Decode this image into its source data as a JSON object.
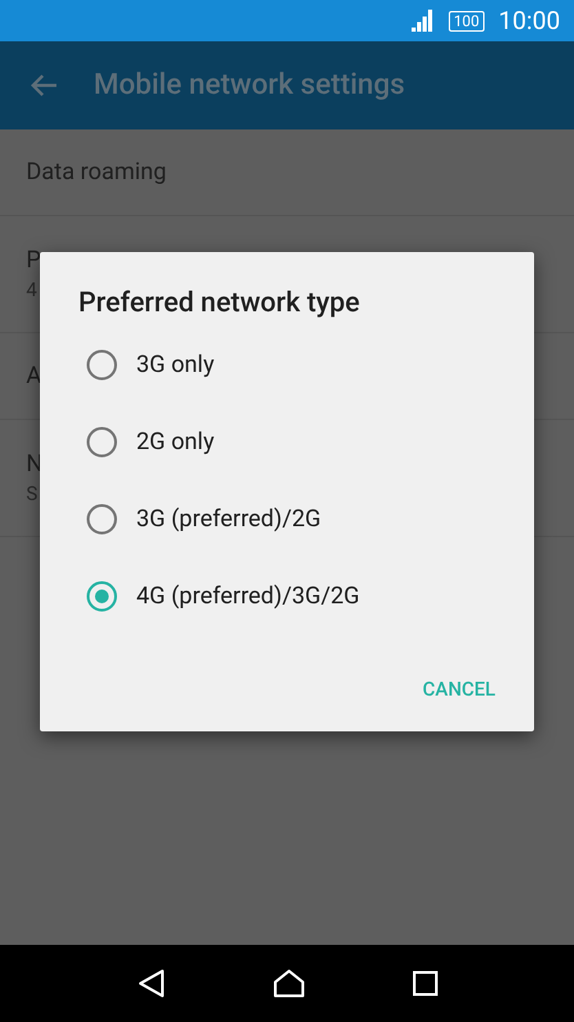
{
  "status_bar": {
    "battery": "100",
    "time": "10:00"
  },
  "app_bar": {
    "title": "Mobile network settings"
  },
  "settings": [
    {
      "title": "Data roaming"
    },
    {
      "title": "P",
      "subtitle": "4"
    },
    {
      "title": "A"
    },
    {
      "title": "N",
      "subtitle": "S"
    }
  ],
  "dialog": {
    "title": "Preferred network type",
    "options": [
      {
        "label": "3G only",
        "selected": false
      },
      {
        "label": "2G only",
        "selected": false
      },
      {
        "label": "3G (preferred)/2G",
        "selected": false
      },
      {
        "label": "4G (preferred)/3G/2G",
        "selected": true
      }
    ],
    "buttons": [
      "CANCEL"
    ]
  }
}
